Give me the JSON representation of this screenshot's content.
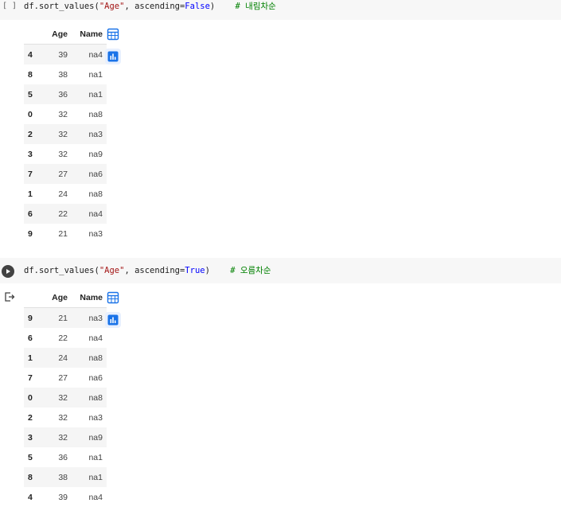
{
  "cells": [
    {
      "prompt": "[ ]",
      "code": {
        "prefix": "df.sort_values(",
        "arg_str": "\"Age\"",
        "mid": ", ascending=",
        "kw": "False",
        "suffix": ")",
        "gap": "    ",
        "comment": "# 내림차순"
      },
      "table": {
        "columns": [
          "Age",
          "Name"
        ],
        "rows": [
          {
            "index": "4",
            "age": "39",
            "name": "na4"
          },
          {
            "index": "8",
            "age": "38",
            "name": "na1"
          },
          {
            "index": "5",
            "age": "36",
            "name": "na1"
          },
          {
            "index": "0",
            "age": "32",
            "name": "na8"
          },
          {
            "index": "2",
            "age": "32",
            "name": "na3"
          },
          {
            "index": "3",
            "age": "32",
            "name": "na9"
          },
          {
            "index": "7",
            "age": "27",
            "name": "na6"
          },
          {
            "index": "1",
            "age": "24",
            "name": "na8"
          },
          {
            "index": "6",
            "age": "22",
            "name": "na4"
          },
          {
            "index": "9",
            "age": "21",
            "name": "na3"
          }
        ]
      }
    },
    {
      "prompt": "",
      "code": {
        "prefix": "df.sort_values(",
        "arg_str": "\"Age\"",
        "mid": ", ascending=",
        "kw": "True",
        "suffix": ")",
        "gap": "    ",
        "comment": "# 오름차순"
      },
      "table": {
        "columns": [
          "Age",
          "Name"
        ],
        "rows": [
          {
            "index": "9",
            "age": "21",
            "name": "na3"
          },
          {
            "index": "6",
            "age": "22",
            "name": "na4"
          },
          {
            "index": "1",
            "age": "24",
            "name": "na8"
          },
          {
            "index": "7",
            "age": "27",
            "name": "na6"
          },
          {
            "index": "0",
            "age": "32",
            "name": "na8"
          },
          {
            "index": "2",
            "age": "32",
            "name": "na3"
          },
          {
            "index": "3",
            "age": "32",
            "name": "na9"
          },
          {
            "index": "5",
            "age": "36",
            "name": "na1"
          },
          {
            "index": "8",
            "age": "38",
            "name": "na1"
          },
          {
            "index": "4",
            "age": "39",
            "name": "na4"
          }
        ]
      }
    }
  ],
  "icons": {
    "run": "play-circle-icon",
    "output": "output-redirect-icon",
    "table_view": "table-view-icon",
    "chart_view": "bar-chart-icon"
  },
  "colors": {
    "accent": "#1a73e8",
    "code_bg": "#f7f7f7",
    "string": "#a31515",
    "keyword": "#0000ff",
    "comment": "#008000"
  }
}
